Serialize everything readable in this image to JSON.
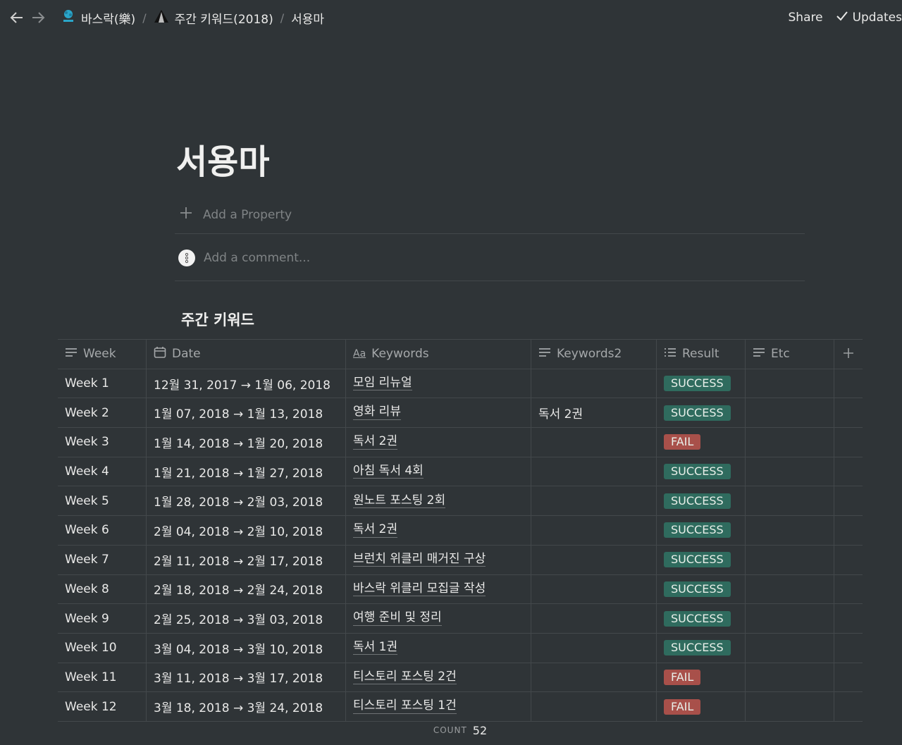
{
  "breadcrumb": {
    "workspace": "바스락(樂)",
    "parent": "주간 키워드(2018)",
    "current": "서용마"
  },
  "actions": {
    "share": "Share",
    "updates": "Updates"
  },
  "page": {
    "title": "서용마",
    "add_property": "Add a Property",
    "add_comment": "Add a comment..."
  },
  "table": {
    "title": "주간 키워드",
    "headers": {
      "week": "Week",
      "date": "Date",
      "keywords": "Keywords",
      "keywords2": "Keywords2",
      "result": "Result",
      "etc": "Etc"
    },
    "rows": [
      {
        "week": "Week 1",
        "date": "12월 31, 2017 → 1월 06, 2018",
        "keywords": "모임 리뉴얼",
        "keywords2": "",
        "result": "SUCCESS"
      },
      {
        "week": "Week 2",
        "date": "1월 07, 2018 → 1월 13, 2018",
        "keywords": "영화 리뷰",
        "keywords2": "독서 2권",
        "result": "SUCCESS"
      },
      {
        "week": "Week 3",
        "date": "1월 14, 2018 → 1월 20, 2018",
        "keywords": "독서 2권",
        "keywords2": "",
        "result": "FAIL"
      },
      {
        "week": "Week 4",
        "date": "1월 21, 2018 → 1월 27, 2018",
        "keywords": "아침 독서 4회",
        "keywords2": "",
        "result": "SUCCESS"
      },
      {
        "week": "Week 5",
        "date": "1월 28, 2018 → 2월 03, 2018",
        "keywords": "원노트 포스팅 2회",
        "keywords2": "",
        "result": "SUCCESS"
      },
      {
        "week": "Week 6",
        "date": "2월 04, 2018 → 2월 10, 2018",
        "keywords": "독서 2권",
        "keywords2": "",
        "result": "SUCCESS"
      },
      {
        "week": "Week 7",
        "date": "2월 11, 2018 → 2월 17, 2018",
        "keywords": "브런치 위클리 매거진 구상",
        "keywords2": "",
        "result": "SUCCESS"
      },
      {
        "week": "Week 8",
        "date": "2월 18, 2018 → 2월 24, 2018",
        "keywords": "바스락 위클리 모집글 작성",
        "keywords2": "",
        "result": "SUCCESS"
      },
      {
        "week": "Week 9",
        "date": "2월 25, 2018 → 3월 03, 2018",
        "keywords": "여행 준비 및 정리",
        "keywords2": "",
        "result": "SUCCESS"
      },
      {
        "week": "Week 10",
        "date": "3월 04, 2018 → 3월 10, 2018",
        "keywords": "독서 1권",
        "keywords2": "",
        "result": "SUCCESS"
      },
      {
        "week": "Week 11",
        "date": "3월 11, 2018 → 3월 17, 2018",
        "keywords": "티스토리 포스팅 2건",
        "keywords2": "",
        "result": "FAIL"
      },
      {
        "week": "Week 12",
        "date": "3월 18, 2018 → 3월 24, 2018",
        "keywords": "티스토리 포스팅 1건",
        "keywords2": "",
        "result": "FAIL"
      }
    ],
    "count_label": "COUNT",
    "count_value": "52"
  },
  "colors": {
    "background": "#2f3437",
    "success": "#2f6b5e",
    "fail": "#a8504a",
    "border": "#43484b"
  },
  "icons": {
    "back": "arrow-left-icon",
    "forward": "arrow-right-icon",
    "workspace": "workspace-logo-icon",
    "parent": "triangle-page-icon",
    "updates": "check-icon",
    "add_property": "plus-icon",
    "comment_avatar": "avatar-icon",
    "text_prop": "text-lines-icon",
    "date_prop": "calendar-icon",
    "title_prop": "aa-title-icon",
    "select_prop": "list-icon",
    "add_column": "plus-icon"
  }
}
